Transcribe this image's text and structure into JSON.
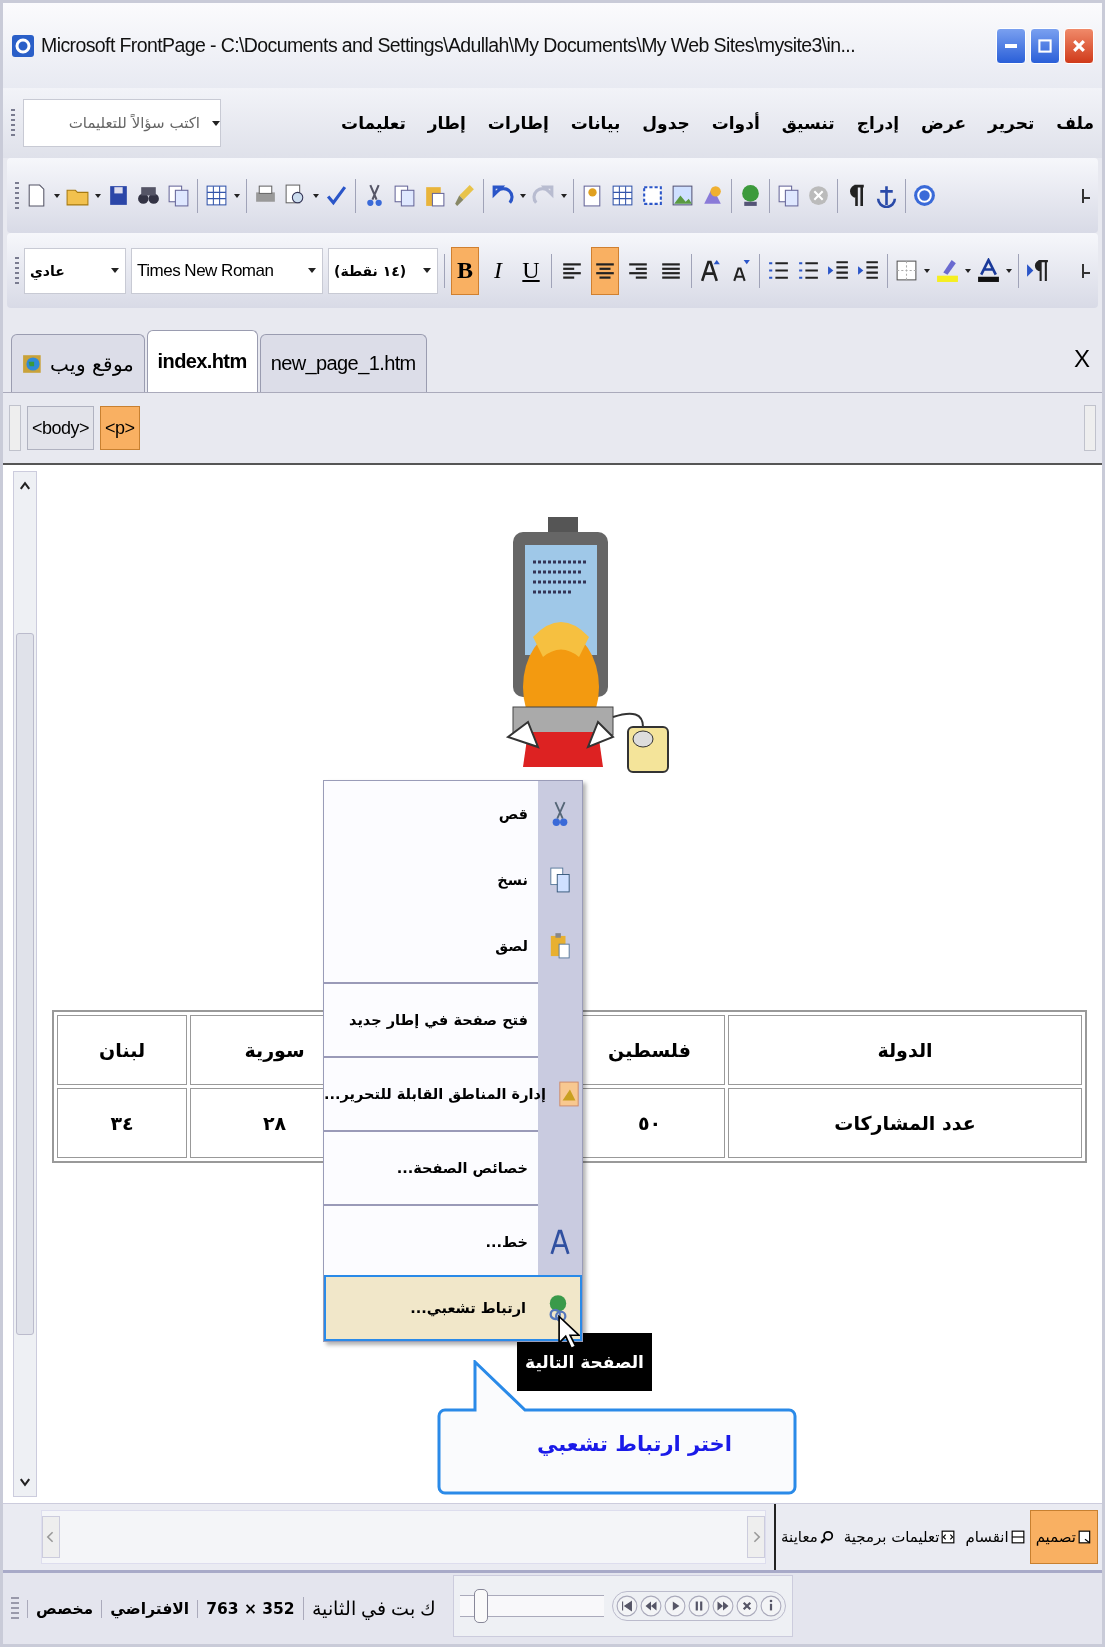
{
  "window": {
    "title": "Microsoft FrontPage - C:\\Documents and Settings\\Adullah\\My Documents\\My Web Sites\\mysite3\\in..."
  },
  "menu_bar": {
    "items": [
      "ملف",
      "تحرير",
      "عرض",
      "إدراج",
      "تنسيق",
      "أدوات",
      "جدول",
      "بيانات",
      "إطارات",
      "إطار",
      "تعليمات"
    ],
    "help_search": {
      "placeholder": "اكتب سؤالاً للتعليمات"
    }
  },
  "formatting_toolbar": {
    "style": "عادي",
    "font": "Times New Roman",
    "size": "(١٤ نقطة)",
    "buttons": [
      {
        "kind": "justify",
        "on": false
      },
      {
        "kind": "align-right",
        "on": false
      },
      {
        "kind": "align-center",
        "on": true
      },
      {
        "kind": "align-left",
        "on": false
      },
      {
        "kind": "underline",
        "label": "U",
        "on": false
      },
      {
        "kind": "italic",
        "label": "I",
        "on": false
      },
      {
        "kind": "bold",
        "label": "B",
        "on": true
      }
    ]
  },
  "document_tabs": {
    "items": [
      {
        "kind": "file",
        "label": "new_page_1.htm",
        "selected": false
      },
      {
        "kind": "file",
        "label": "index.htm",
        "selected": true
      },
      {
        "kind": "site",
        "label": "موقع ويب",
        "selected": false
      }
    ],
    "close": "X"
  },
  "tag_path": [
    {
      "label": "<p>",
      "selected": true
    },
    {
      "label": "<body>",
      "selected": false
    }
  ],
  "page": {
    "table": {
      "rows": [
        [
          "الدولة",
          "فلسطين",
          null,
          "سورية",
          "لبنان"
        ],
        [
          "عدد المشاركات",
          "٥٠",
          null,
          "٢٨",
          "٣٤"
        ]
      ]
    },
    "button": "الصفحة التالية"
  },
  "context_menu": {
    "items": [
      {
        "kind": "cut",
        "label": "قص",
        "selected": false
      },
      {
        "kind": "copy",
        "label": "نسخ",
        "selected": false
      },
      {
        "kind": "paste",
        "label": "لصق",
        "selected": false
      },
      {
        "kind": "separator"
      },
      {
        "kind": "plain",
        "label": "فتح صفحة في إطار جديد",
        "selected": false
      },
      {
        "kind": "separator"
      },
      {
        "kind": "regions",
        "label": "إدارة المناطق القابلة للتحرير...",
        "selected": false
      },
      {
        "kind": "separator"
      },
      {
        "kind": "plain",
        "label": "خصائص الصفحة...",
        "selected": false
      },
      {
        "kind": "separator"
      },
      {
        "kind": "font",
        "label": "خط...",
        "selected": false
      },
      {
        "kind": "hyperlink",
        "label": "ارتباط تشعبي...",
        "selected": true
      }
    ]
  },
  "callout": {
    "text": "اختر ارتباط تشعبي"
  },
  "view_tabs": [
    {
      "kind": "design",
      "label": "تصميم",
      "selected": true
    },
    {
      "kind": "split",
      "label": "انقسام",
      "selected": false
    },
    {
      "kind": "code",
      "label": "تعليمات برمجية",
      "selected": false
    },
    {
      "kind": "preview",
      "label": "معاينة",
      "selected": false
    }
  ],
  "status_bar": {
    "items": [
      "ك بت في الثانية",
      "763 × 352",
      "الافتراضي",
      "مخصص"
    ]
  },
  "media_player": {
    "seek": {
      "level": 0.1
    }
  }
}
